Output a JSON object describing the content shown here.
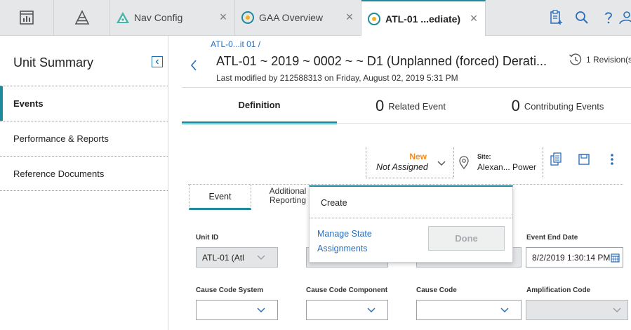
{
  "topbar": {
    "tabs": [
      {
        "label": "Nav Config"
      },
      {
        "label": "GAA Overview"
      },
      {
        "label": "ATL-01 ...ediate)"
      }
    ],
    "close_glyph": "×"
  },
  "left_panel": {
    "title": "Unit Summary",
    "items": [
      {
        "label": "Events",
        "active": true
      },
      {
        "label": "Performance & Reports"
      },
      {
        "label": "Reference Documents"
      }
    ]
  },
  "header": {
    "breadcrumb": "ATL-0...it 01 /",
    "title": "ATL-01 ~ 2019 ~ 0002 ~ ~ D1 (Unplanned (forced) Derati...",
    "subtitle": "Last modified by 212588313 on Friday, August 02, 2019 5:31 PM",
    "revisions": "1 Revision(s"
  },
  "section_tabs": {
    "definition": "Definition",
    "related_count": "0",
    "related_label": "Related Event",
    "contrib_count": "0",
    "contrib_label": "Contributing Events"
  },
  "state": {
    "status": "New",
    "assignment": "Not Assigned"
  },
  "site": {
    "label": "Site:",
    "value": "Alexan... Power"
  },
  "inner_tabs": {
    "event": "Event",
    "additional_line1": "Additional",
    "additional_line2": "Reporting"
  },
  "form": {
    "unit_id_label": "Unit ID",
    "unit_id_value": "ATL-01 (Atl",
    "event_end_date_label": "Event End Date",
    "event_end_date_value": "8/2/2019 1:30:14 PM",
    "cause_code_system_label": "Cause Code System",
    "cause_code_component_label": "Cause Code Component",
    "cause_code_label": "Cause Code",
    "amplification_code_label": "Amplification Code"
  },
  "popup": {
    "create": "Create",
    "manage_line1": "Manage State",
    "manage_line2": "Assignments",
    "done": "Done"
  },
  "colors": {
    "accent": "#1f8a9b",
    "link": "#2a6ebb",
    "status_new": "#f28c1b"
  }
}
